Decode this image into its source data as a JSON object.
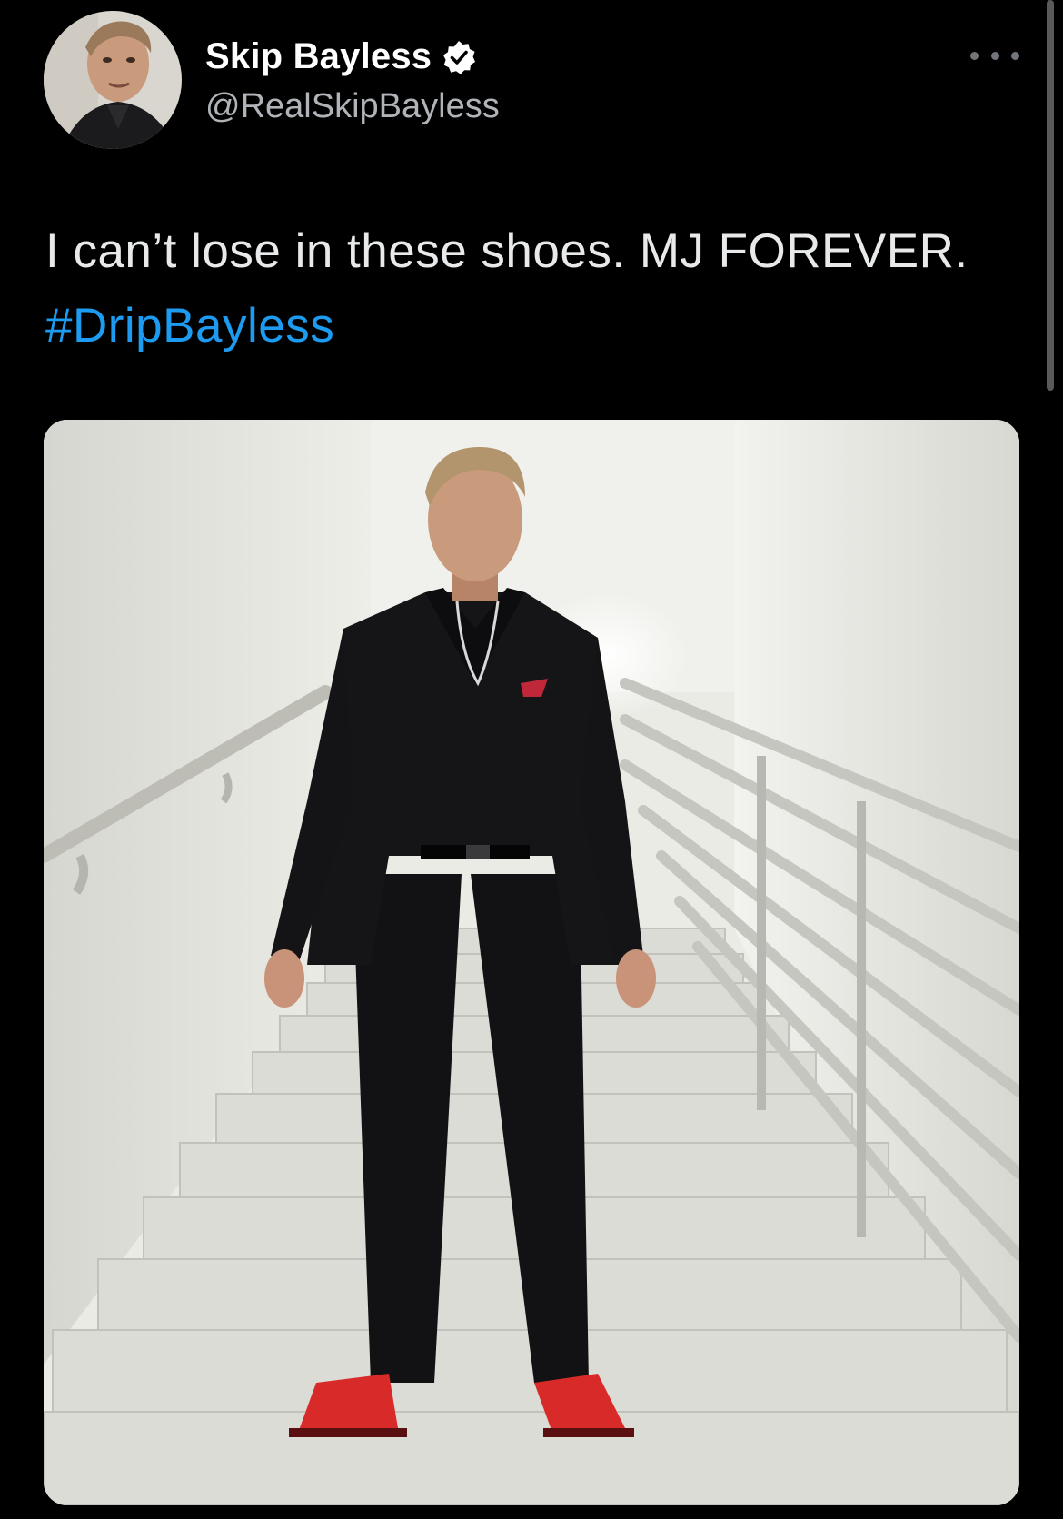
{
  "tweet": {
    "author": {
      "display_name": "Skip Bayless",
      "handle": "@RealSkipBayless",
      "verified": true
    },
    "text": "I can’t lose in these shoes. MJ FOREVER.",
    "hashtag": "#DripBayless",
    "media": {
      "type": "photo"
    }
  },
  "icons": {
    "verified": "verified-badge-icon",
    "more": "more-options-icon"
  },
  "colors": {
    "background": "#000000",
    "text": "#e7e9ea",
    "hashtag": "#1d9bf0",
    "handle": "#b0b4b8"
  }
}
